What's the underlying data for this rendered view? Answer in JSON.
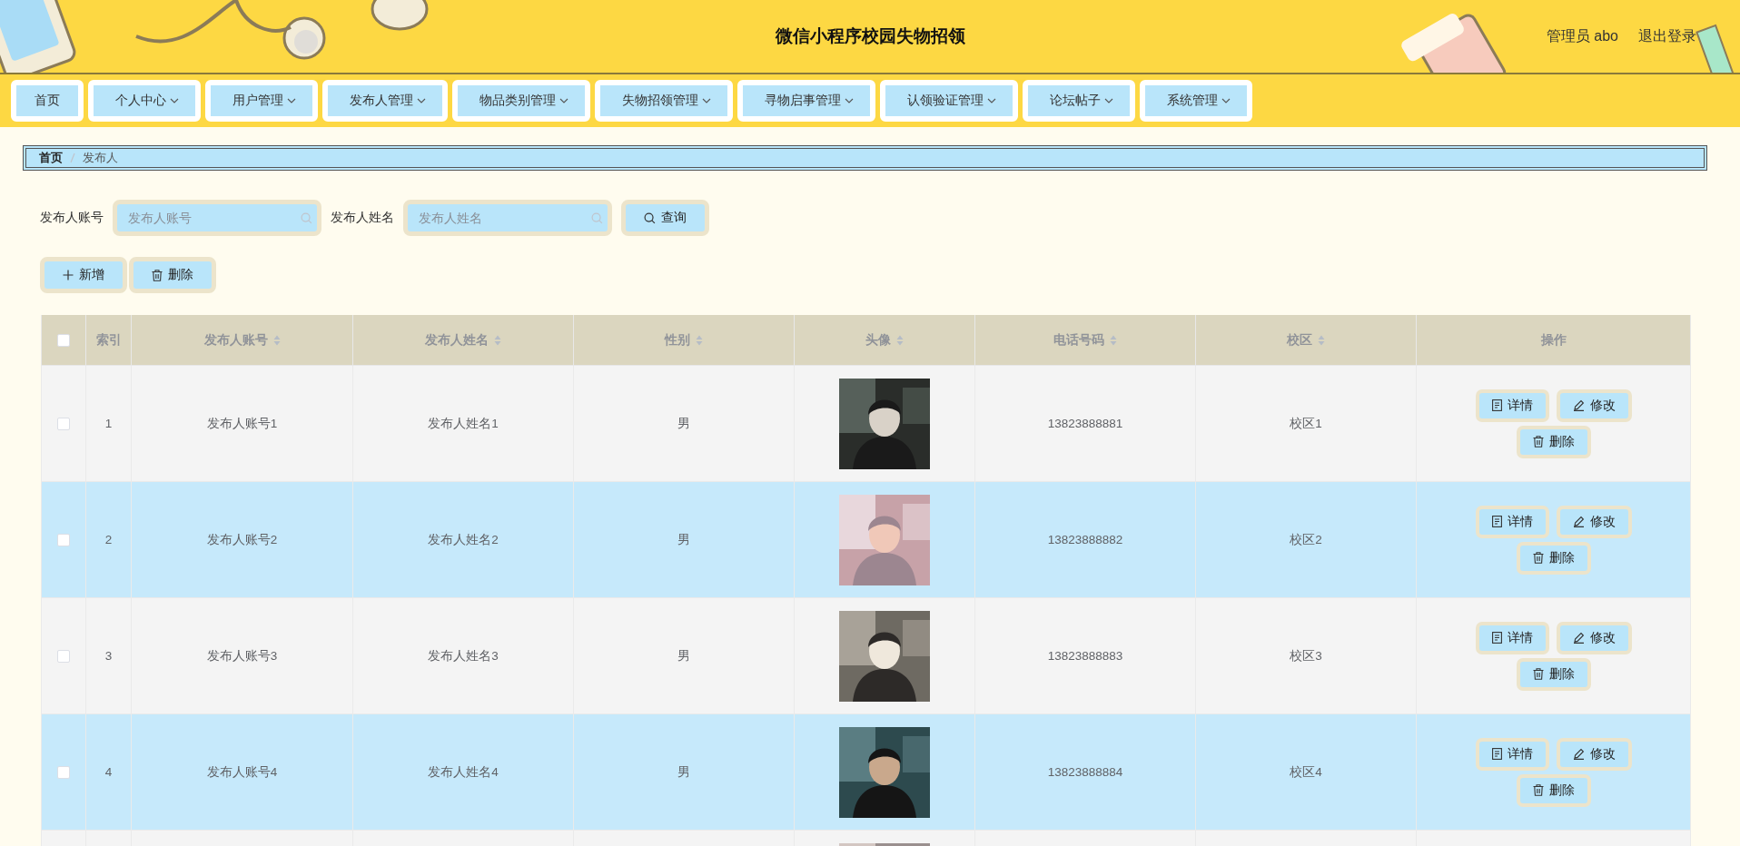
{
  "header": {
    "title": "微信小程序校园失物招领",
    "user": "管理员 abo",
    "logout": "退出登录"
  },
  "nav": [
    {
      "label": "首页",
      "dropdown": false
    },
    {
      "label": "个人中心",
      "dropdown": true
    },
    {
      "label": "用户管理",
      "dropdown": true
    },
    {
      "label": "发布人管理",
      "dropdown": true
    },
    {
      "label": "物品类别管理",
      "dropdown": true
    },
    {
      "label": "失物招领管理",
      "dropdown": true
    },
    {
      "label": "寻物启事管理",
      "dropdown": true
    },
    {
      "label": "认领验证管理",
      "dropdown": true
    },
    {
      "label": "论坛帖子",
      "dropdown": true
    },
    {
      "label": "系统管理",
      "dropdown": true
    }
  ],
  "breadcrumb": [
    "首页",
    "发布人"
  ],
  "search": {
    "fields": [
      {
        "label": "发布人账号",
        "placeholder": "发布人账号"
      },
      {
        "label": "发布人姓名",
        "placeholder": "发布人姓名"
      }
    ],
    "button": "查询"
  },
  "actions": [
    {
      "kind": "add",
      "label": "新增"
    },
    {
      "kind": "delete",
      "label": "删除"
    }
  ],
  "table": {
    "columns": [
      {
        "kind": "checkbox",
        "checked": false
      },
      {
        "kind": "text",
        "label": "索引",
        "sortable": false
      },
      {
        "kind": "text",
        "label": "发布人账号",
        "sortable": true
      },
      {
        "kind": "text",
        "label": "发布人姓名",
        "sortable": true
      },
      {
        "kind": "text",
        "label": "性别",
        "sortable": true
      },
      {
        "kind": "text",
        "label": "头像",
        "sortable": true
      },
      {
        "kind": "text",
        "label": "电话号码",
        "sortable": true
      },
      {
        "kind": "text",
        "label": "校区",
        "sortable": true
      },
      {
        "kind": "text",
        "label": "操作",
        "sortable": false
      }
    ],
    "rows": [
      {
        "checked": false,
        "index": "1",
        "account": "发布人账号1",
        "name": "发布人姓名1",
        "gender": "男",
        "avatar": {
          "kind": "picture"
        },
        "phone": "13823888881",
        "campus": "校区1",
        "buttons": [
          {
            "kind": "detail",
            "label": "详情"
          },
          {
            "kind": "edit",
            "label": "修改"
          },
          {
            "kind": "delete",
            "label": "删除"
          }
        ]
      },
      {
        "checked": false,
        "index": "2",
        "account": "发布人账号2",
        "name": "发布人姓名2",
        "gender": "男",
        "avatar": {
          "kind": "picture"
        },
        "phone": "13823888882",
        "campus": "校区2",
        "buttons": [
          {
            "kind": "detail",
            "label": "详情"
          },
          {
            "kind": "edit",
            "label": "修改"
          },
          {
            "kind": "delete",
            "label": "删除"
          }
        ]
      },
      {
        "checked": false,
        "index": "3",
        "account": "发布人账号3",
        "name": "发布人姓名3",
        "gender": "男",
        "avatar": {
          "kind": "picture"
        },
        "phone": "13823888883",
        "campus": "校区3",
        "buttons": [
          {
            "kind": "detail",
            "label": "详情"
          },
          {
            "kind": "edit",
            "label": "修改"
          },
          {
            "kind": "delete",
            "label": "删除"
          }
        ]
      },
      {
        "checked": false,
        "index": "4",
        "account": "发布人账号4",
        "name": "发布人姓名4",
        "gender": "男",
        "avatar": {
          "kind": "picture"
        },
        "phone": "13823888884",
        "campus": "校区4",
        "buttons": [
          {
            "kind": "detail",
            "label": "详情"
          },
          {
            "kind": "edit",
            "label": "修改"
          },
          {
            "kind": "delete",
            "label": "删除"
          }
        ]
      },
      {
        "avatar": {
          "kind": "picture"
        }
      }
    ]
  }
}
